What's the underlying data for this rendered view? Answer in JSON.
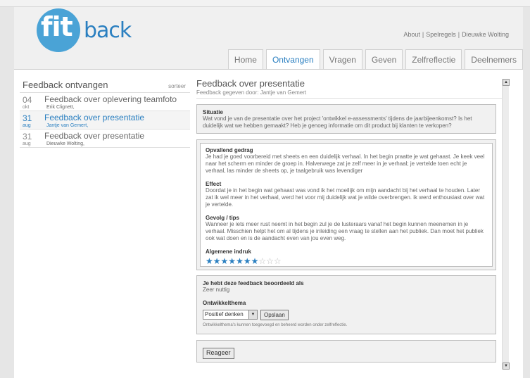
{
  "header": {
    "logo_fit": "fit",
    "logo_back": "back",
    "links": [
      "About",
      "Spelregels",
      "Dieuwke Wolting"
    ]
  },
  "nav": {
    "tabs": [
      {
        "label": "Home",
        "active": false
      },
      {
        "label": "Ontvangen",
        "active": true
      },
      {
        "label": "Vragen",
        "active": false
      },
      {
        "label": "Geven",
        "active": false
      },
      {
        "label": "Zelfreflectie",
        "active": false
      },
      {
        "label": "Deelnemers",
        "active": false
      }
    ]
  },
  "sidebar": {
    "title": "Feedback ontvangen",
    "sort_label": "sorteer",
    "items": [
      {
        "day": "04",
        "month": "okt",
        "title": "Feedback over oplevering teamfoto",
        "author": "Erik Clignett,",
        "active": false
      },
      {
        "day": "31",
        "month": "aug",
        "title": "Feedback over presentatie",
        "author": "Jantje van Gemert,",
        "active": true
      },
      {
        "day": "31",
        "month": "aug",
        "title": "Feedback over presentatie",
        "author": "Dieuwke Wolting,",
        "active": false
      }
    ]
  },
  "main": {
    "title": "Feedback over presentatie",
    "subtitle": "Feedback gegeven door: Jantje van Gemert",
    "situatie": {
      "heading": "Situatie",
      "text": "Wat vond je van de presentatie over het project 'ontwikkel e-assessments' tijdens de jaarbijeenkomst? Is het duidelijk wat we hebben gemaakt? Heb je genoeg informatie om dit product bij klanten te verkopen?"
    },
    "opvallend": {
      "heading": "Opvallend gedrag",
      "text": "Je had je goed voorbereid met sheets en een duidelijk verhaal. In het begin praatte je wat gehaast. Je keek veel naar het scherm en minder de groep in. Halverwege zat je zelf meer in je verhaal; je vertelde toen echt je verhaal, las minder de sheets op, je taalgebruik was levendiger"
    },
    "effect": {
      "heading": "Effect",
      "text": "Doordat je in het begin wat gehaast was vond ik het moeilijk om mijn aandacht bij het verhaal te houden. Later zat ik wel meer in het verhaal, werd het voor mij duidelijk wat je wilde overbrengen. ik werd enthousiast over wat je vertelde."
    },
    "gevolg": {
      "heading": "Gevolg / tips",
      "text": "Wanneer je iets meer rust neemt in het begin zul je de lusteraars vanaf het begin kunnen meenemen in je verhaal. Misschien helpt het om al tijdens je inleiding een vraag te stellen aan het publiek. Dan moet het publiek ook wat doen en is de aandacht even van jou even weg."
    },
    "indruk": {
      "heading": "Algemene indruk",
      "stars_filled": 7,
      "stars_total": 10
    },
    "rating": {
      "heading": "Je hebt deze feedback beoordeeld als",
      "value": "Zeer nuttig",
      "theme_heading": "Ontwikkelthema",
      "theme_selected": "Positief denken",
      "save_label": "Opslaan",
      "note": "Ontwikkelthema's kunnen toegevoegd en beheerd worden onder zelfreflectie."
    },
    "reply_label": "Reageer"
  },
  "colors": {
    "accent": "#2a7fc0",
    "logo_circle": "#4aa3d6"
  }
}
